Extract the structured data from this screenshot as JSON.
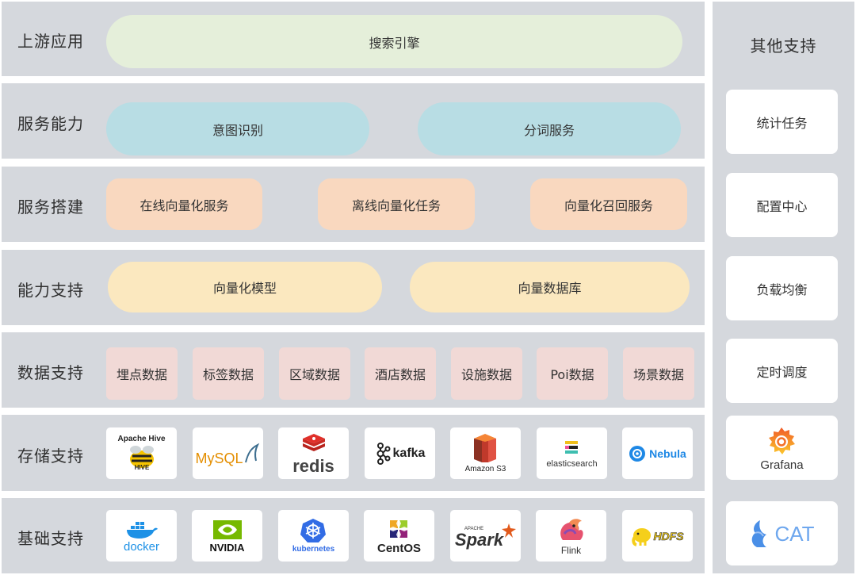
{
  "layers": [
    {
      "label": "上游应用"
    },
    {
      "label": "服务能力"
    },
    {
      "label": "服务搭建"
    },
    {
      "label": "能力支持"
    },
    {
      "label": "数据支持"
    },
    {
      "label": "存储支持"
    },
    {
      "label": "基础支持"
    }
  ],
  "upstream": {
    "items": [
      "搜索引擎"
    ]
  },
  "service_capability": {
    "items": [
      "意图识别",
      "分词服务"
    ]
  },
  "service_building": {
    "items": [
      "在线向量化服务",
      "离线向量化任务",
      "向量化召回服务"
    ]
  },
  "capability_support": {
    "items": [
      "向量化模型",
      "向量数据库"
    ]
  },
  "data_support": {
    "items": [
      "埋点数据",
      "标签数据",
      "区域数据",
      "酒店数据",
      "设施数据",
      "Poi数据",
      "场景数据"
    ]
  },
  "storage_support": {
    "logos": [
      {
        "name": "Apache Hive",
        "icon": "hive-bee-icon"
      },
      {
        "name": "MySQL",
        "icon": "dolphin-icon"
      },
      {
        "name": "redis",
        "icon": "redis-cube-icon"
      },
      {
        "name": "kafka",
        "icon": "kafka-nodes-icon"
      },
      {
        "name": "Amazon S3",
        "icon": "s3-bucket-icon"
      },
      {
        "name": "elasticsearch",
        "icon": "elastic-icon"
      },
      {
        "name": "Nebula",
        "icon": "nebula-icon"
      }
    ]
  },
  "infra_support": {
    "logos": [
      {
        "name": "docker",
        "icon": "whale-icon"
      },
      {
        "name": "NVIDIA",
        "icon": "nvidia-eye-icon"
      },
      {
        "name": "kubernetes",
        "icon": "helm-wheel-icon"
      },
      {
        "name": "CentOS",
        "icon": "centos-star-icon"
      },
      {
        "name": "Spark",
        "icon": "spark-star-icon",
        "prefix": "APACHE"
      },
      {
        "name": "Flink",
        "icon": "squirrel-icon"
      },
      {
        "name": "HDFS",
        "icon": "elephant-icon"
      }
    ]
  },
  "other_support": {
    "title": "其他支持",
    "items": [
      "统计任务",
      "配置中心",
      "负载均衡",
      "定时调度"
    ],
    "logos": [
      {
        "name": "Grafana",
        "icon": "grafana-icon"
      },
      {
        "name": "CAT",
        "icon": "cat-icon"
      }
    ]
  },
  "colors": {
    "panel": "#d5d8dd",
    "upstream": "#e5efda",
    "service_capability": "#b8dde4",
    "service_building": "#f9d8bf",
    "capability_support": "#fbe8bf",
    "data_support": "#f1d9d6"
  }
}
